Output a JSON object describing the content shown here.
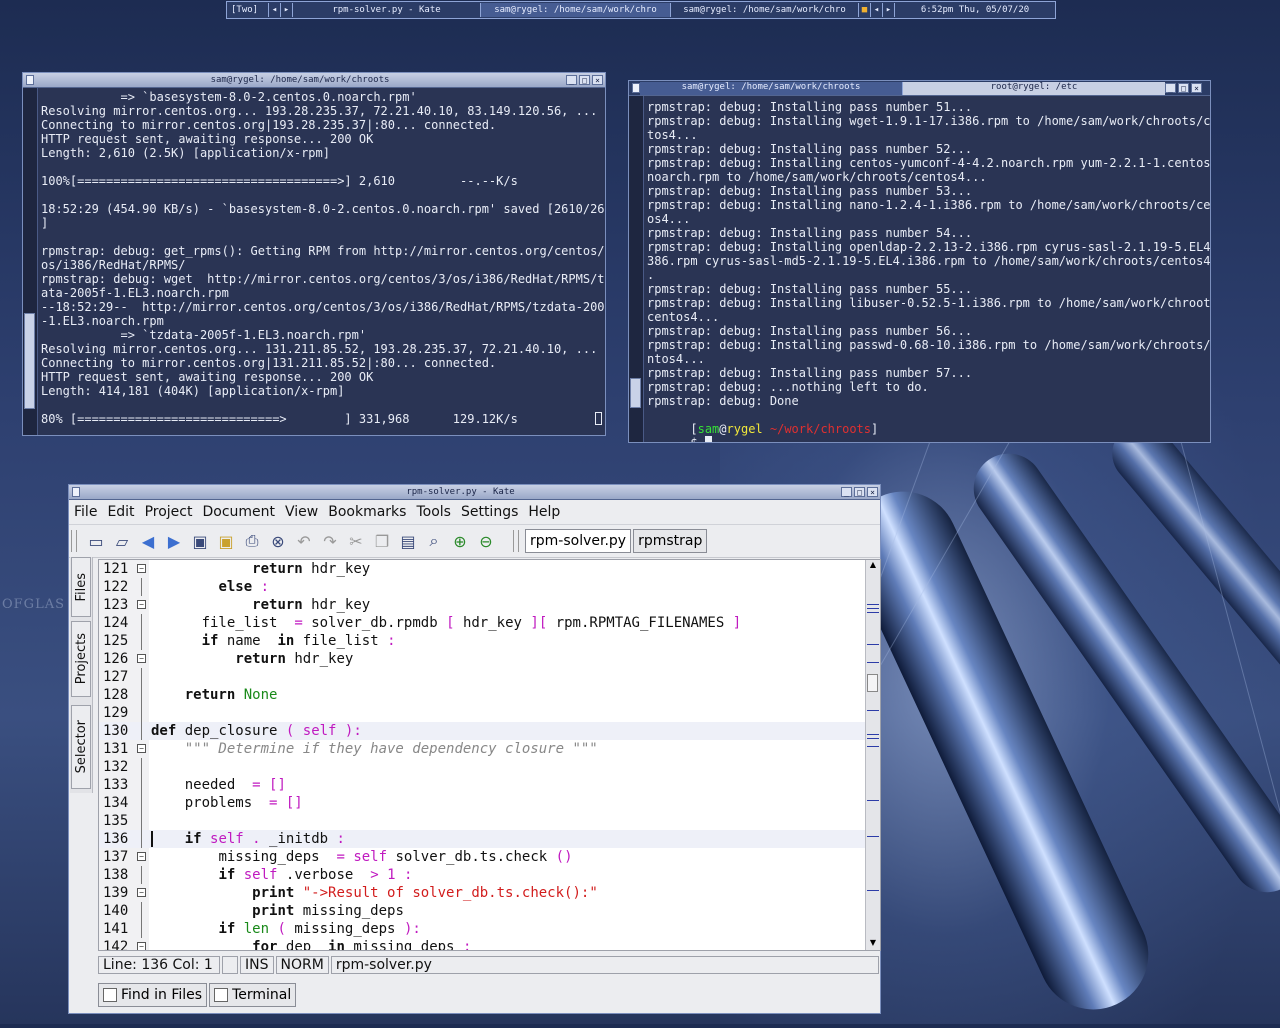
{
  "panel": {
    "desktop": "[Two]",
    "tasks": [
      "rpm-solver.py - Kate",
      "sam@rygel: /home/sam/work/chro",
      "sam@rygel: /home/sam/work/chro"
    ],
    "clock": "6:52pm Thu, 05/07/20"
  },
  "background": {
    "logo_text": "OFGLAS"
  },
  "term1": {
    "title": "sam@rygel: /home/sam/work/chroots",
    "lines": [
      "           => `basesystem-8.0-2.centos.0.noarch.rpm'",
      "Resolving mirror.centos.org... 193.28.235.37, 72.21.40.10, 83.149.120.56, ...",
      "Connecting to mirror.centos.org|193.28.235.37|:80... connected.",
      "HTTP request sent, awaiting response... 200 OK",
      "Length: 2,610 (2.5K) [application/x-rpm]",
      "",
      "100%[====================================>] 2,610         --.--K/s",
      "",
      "18:52:29 (454.90 KB/s) - `basesystem-8.0-2.centos.0.noarch.rpm' saved [2610/2610",
      "]",
      "",
      "rpmstrap: debug: get_rpms(): Getting RPM from http://mirror.centos.org/centos/3/",
      "os/i386/RedHat/RPMS/",
      "rpmstrap: debug: wget  http://mirror.centos.org/centos/3/os/i386/RedHat/RPMS/tzd",
      "ata-2005f-1.EL3.noarch.rpm",
      "--18:52:29--  http://mirror.centos.org/centos/3/os/i386/RedHat/RPMS/tzdata-2005f",
      "-1.EL3.noarch.rpm",
      "           => `tzdata-2005f-1.EL3.noarch.rpm'",
      "Resolving mirror.centos.org... 131.211.85.52, 193.28.235.37, 72.21.40.10, ...",
      "Connecting to mirror.centos.org|131.211.85.52|:80... connected.",
      "HTTP request sent, awaiting response... 200 OK",
      "Length: 414,181 (404K) [application/x-rpm]",
      "",
      "80% [============================>        ] 331,968      129.12K/s"
    ]
  },
  "term2": {
    "tabs": [
      "sam@rygel: /home/sam/work/chroots",
      "root@rygel: /etc"
    ],
    "lines": [
      "rpmstrap: debug: Installing pass number 51...",
      "rpmstrap: debug: Installing wget-1.9.1-17.i386.rpm to /home/sam/work/chroots/cen",
      "tos4...",
      "rpmstrap: debug: Installing pass number 52...",
      "rpmstrap: debug: Installing centos-yumconf-4-4.2.noarch.rpm yum-2.2.1-1.centos4.",
      "noarch.rpm to /home/sam/work/chroots/centos4...",
      "rpmstrap: debug: Installing pass number 53...",
      "rpmstrap: debug: Installing nano-1.2.4-1.i386.rpm to /home/sam/work/chroots/cent",
      "os4...",
      "rpmstrap: debug: Installing pass number 54...",
      "rpmstrap: debug: Installing openldap-2.2.13-2.i386.rpm cyrus-sasl-2.1.19-5.EL4.i",
      "386.rpm cyrus-sasl-md5-2.1.19-5.EL4.i386.rpm to /home/sam/work/chroots/centos4..",
      ".",
      "rpmstrap: debug: Installing pass number 55...",
      "rpmstrap: debug: Installing libuser-0.52.5-1.i386.rpm to /home/sam/work/chroots/",
      "centos4...",
      "rpmstrap: debug: Installing pass number 56...",
      "rpmstrap: debug: Installing passwd-0.68-10.i386.rpm to /home/sam/work/chroots/ce",
      "ntos4...",
      "rpmstrap: debug: Installing pass number 57...",
      "rpmstrap: debug: ...nothing left to do.",
      "rpmstrap: debug: Done"
    ],
    "prompt": {
      "open": "[",
      "user": "sam",
      "at": "@",
      "host": "rygel",
      "path": " ~/work/chroots",
      "close": "]",
      "dollar": "$ "
    }
  },
  "kate": {
    "title": "rpm-solver.py - Kate",
    "menu": [
      "File",
      "Edit",
      "Project",
      "Document",
      "View",
      "Bookmarks",
      "Tools",
      "Settings",
      "Help"
    ],
    "doc_tabs": [
      "rpm-solver.py",
      "rpmstrap"
    ],
    "side_tabs": [
      "Files",
      "Projects",
      "Selector"
    ],
    "toolbar_icons": [
      "new-document-icon",
      "open-folder-icon",
      "back-icon",
      "forward-icon",
      "save-icon",
      "save-as-icon",
      "print-icon",
      "close-document-icon",
      "undo-icon",
      "redo-icon",
      "cut-icon",
      "copy-icon",
      "paste-icon",
      "find-icon",
      "zoom-in-icon",
      "zoom-out-icon"
    ],
    "status": {
      "position": "Line: 136 Col: 1",
      "mode": "INS",
      "norm": "NORM",
      "file": "rpm-solver.py"
    },
    "bottom_tabs": [
      "Find in Files",
      "Terminal"
    ],
    "code": [
      {
        "n": "121",
        "fold": true,
        "hl": false,
        "indent": "            ",
        "tokens": [
          [
            "kw",
            "return"
          ],
          [
            "",
            "hdr_key"
          ]
        ]
      },
      {
        "n": "122",
        "fold": false,
        "hl": false,
        "indent": "        ",
        "tokens": [
          [
            "kw",
            "else"
          ],
          [
            "op",
            ":"
          ]
        ]
      },
      {
        "n": "123",
        "fold": true,
        "hl": false,
        "indent": "            ",
        "tokens": [
          [
            "kw",
            "return"
          ],
          [
            "",
            "hdr_key"
          ]
        ]
      },
      {
        "n": "124",
        "fold": false,
        "hl": false,
        "indent": "      ",
        "tokens": [
          [
            "",
            "file_list "
          ],
          [
            "op",
            "="
          ],
          [
            "",
            "solver_db.rpmdb"
          ],
          [
            "op",
            "["
          ],
          [
            "",
            "hdr_key"
          ],
          [
            "op",
            "]["
          ],
          [
            "",
            "rpm.RPMTAG_FILENAMES"
          ],
          [
            "op",
            "]"
          ]
        ]
      },
      {
        "n": "125",
        "fold": false,
        "hl": false,
        "indent": "      ",
        "tokens": [
          [
            "kw",
            "if"
          ],
          [
            "",
            "name "
          ],
          [
            "kw",
            "in"
          ],
          [
            "",
            "file_list"
          ],
          [
            "op",
            ":"
          ]
        ]
      },
      {
        "n": "126",
        "fold": true,
        "hl": false,
        "indent": "          ",
        "tokens": [
          [
            "kw",
            "return"
          ],
          [
            "",
            "hdr_key"
          ]
        ]
      },
      {
        "n": "127",
        "fold": false,
        "hl": false,
        "indent": "",
        "tokens": []
      },
      {
        "n": "128",
        "fold": false,
        "hl": false,
        "indent": "    ",
        "tokens": [
          [
            "kw",
            "return"
          ],
          [
            "none",
            "None"
          ]
        ]
      },
      {
        "n": "129",
        "fold": false,
        "hl": false,
        "indent": "",
        "tokens": []
      },
      {
        "n": "130",
        "fold": false,
        "hl": true,
        "indent": "",
        "tokens": [
          [
            "kw",
            "def"
          ],
          [
            "",
            "dep_closure"
          ],
          [
            "op",
            "("
          ],
          [
            "num",
            "self"
          ],
          [
            "op",
            "):"
          ]
        ]
      },
      {
        "n": "131",
        "fold": true,
        "hl": false,
        "indent": "    ",
        "tokens": [
          [
            "cm",
            "\"\"\" Determine if they have dependency closure \"\"\""
          ]
        ]
      },
      {
        "n": "132",
        "fold": false,
        "hl": false,
        "indent": "",
        "tokens": []
      },
      {
        "n": "133",
        "fold": false,
        "hl": false,
        "indent": "    ",
        "tokens": [
          [
            "",
            "needed "
          ],
          [
            "op",
            "= []"
          ]
        ]
      },
      {
        "n": "134",
        "fold": false,
        "hl": false,
        "indent": "    ",
        "tokens": [
          [
            "",
            "problems "
          ],
          [
            "op",
            "= []"
          ]
        ]
      },
      {
        "n": "135",
        "fold": false,
        "hl": false,
        "indent": "",
        "tokens": []
      },
      {
        "n": "136",
        "fold": false,
        "hl": true,
        "indent": "    ",
        "tokens": [
          [
            "kw",
            "if"
          ],
          [
            "num",
            "self"
          ],
          [
            "op",
            "."
          ],
          [
            "",
            "_initdb"
          ],
          [
            "op",
            ":"
          ]
        ]
      },
      {
        "n": "137",
        "fold": true,
        "hl": false,
        "indent": "        ",
        "tokens": [
          [
            "",
            "missing_deps "
          ],
          [
            "op",
            "="
          ],
          [
            "num",
            "self"
          ],
          [
            "",
            "solver_db.ts.check"
          ],
          [
            "op",
            "()"
          ]
        ]
      },
      {
        "n": "138",
        "fold": false,
        "hl": false,
        "indent": "        ",
        "tokens": [
          [
            "kw",
            "if"
          ],
          [
            "num",
            "self"
          ],
          [
            "",
            ".verbose "
          ],
          [
            "op",
            ">"
          ],
          [
            "num",
            "1"
          ],
          [
            "op",
            ":"
          ]
        ]
      },
      {
        "n": "139",
        "fold": true,
        "hl": false,
        "indent": "            ",
        "tokens": [
          [
            "kw",
            "print"
          ],
          [
            "str",
            "\"->Result of solver_db.ts.check():\""
          ]
        ]
      },
      {
        "n": "140",
        "fold": false,
        "hl": false,
        "indent": "            ",
        "tokens": [
          [
            "kw",
            "print"
          ],
          [
            "",
            "missing_deps"
          ]
        ]
      },
      {
        "n": "141",
        "fold": false,
        "hl": false,
        "indent": "        ",
        "tokens": [
          [
            "kw",
            "if"
          ],
          [
            "none",
            "len"
          ],
          [
            "op",
            "("
          ],
          [
            "",
            "missing_deps"
          ],
          [
            "op",
            "):"
          ]
        ]
      },
      {
        "n": "142",
        "fold": true,
        "hl": false,
        "indent": "            ",
        "tokens": [
          [
            "kw",
            "for"
          ],
          [
            "",
            "dep "
          ],
          [
            "kw",
            "in"
          ],
          [
            "",
            "missing_deps"
          ],
          [
            "op",
            ":"
          ]
        ]
      }
    ]
  }
}
